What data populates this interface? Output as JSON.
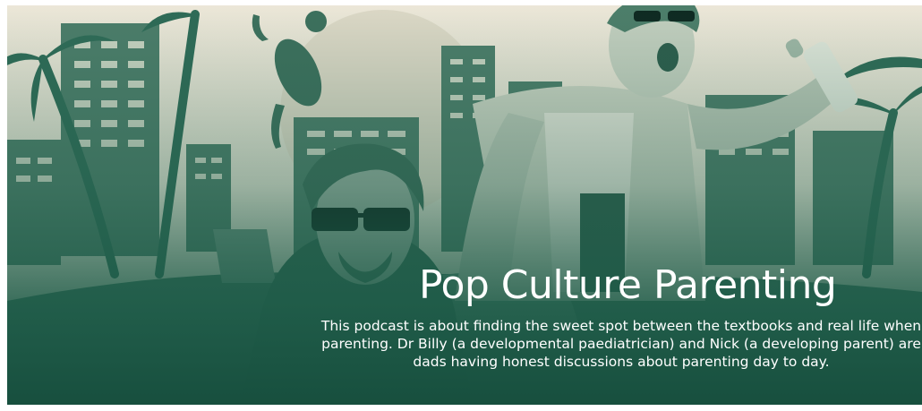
{
  "banner": {
    "title": "Pop Culture Parenting",
    "description_lines": [
      "This podcast is about finding the sweet spot between the textbooks and real life when",
      "parenting. Dr Billy (a developmental paediatrician) and Nick (a developing parent) are",
      "dads having honest discussions about parenting day to day."
    ],
    "colors": {
      "sky": "#e6e2d2",
      "ink": "#1f5a47",
      "mid": "#4f7f6d",
      "light": "#9fb7a6",
      "overlay": "#1d5a47"
    },
    "illustration": "two-men-convertible-car-palm-trees-city-skyline-cat"
  }
}
